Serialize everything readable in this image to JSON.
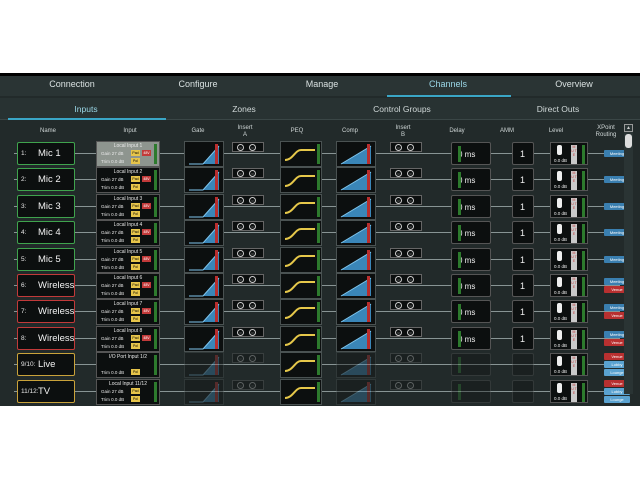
{
  "top_tabs": [
    "Connection",
    "Configure",
    "Manage",
    "Channels",
    "Overview"
  ],
  "active_top_tab": "Channels",
  "sub_tabs": [
    "Inputs",
    "Zones",
    "Control Groups",
    "Direct Outs"
  ],
  "active_sub_tab": "Inputs",
  "headers": {
    "name": "Name",
    "input": "Input",
    "gate": "Gate",
    "insert_a": "Insert\nA",
    "peq": "PEQ",
    "comp": "Comp",
    "insert_b": "Insert\nB",
    "delay": "Delay",
    "amm": "AMM",
    "level": "Level",
    "xpoint": "XPoint\nRouting"
  },
  "input_labels": {
    "gain": "Gain 27 dB",
    "trim": "Trim 0.0 dB",
    "pad": "Pad",
    "phantom": "48V",
    "polarity": "Pol"
  },
  "level_db": "0.0 dB",
  "mute_label": "M U T E",
  "rows": [
    {
      "num": "1:",
      "name": "Mic 1",
      "input": "Local Input 1",
      "delay": "0 ms",
      "amm": "1",
      "color": "green",
      "xpoint": [
        "Meeting"
      ],
      "selected": true
    },
    {
      "num": "2:",
      "name": "Mic 2",
      "input": "Local Input 2",
      "delay": "0 ms",
      "amm": "1",
      "color": "green",
      "xpoint": [
        "Meeting"
      ]
    },
    {
      "num": "3:",
      "name": "Mic 3",
      "input": "Local Input 3",
      "delay": "0 ms",
      "amm": "1",
      "color": "green",
      "xpoint": [
        "Meeting"
      ]
    },
    {
      "num": "4:",
      "name": "Mic 4",
      "input": "Local Input 4",
      "delay": "0 ms",
      "amm": "1",
      "color": "green",
      "xpoint": [
        "Meeting"
      ]
    },
    {
      "num": "5:",
      "name": "Mic 5",
      "input": "Local Input 5",
      "delay": "0 ms",
      "amm": "1",
      "color": "green",
      "xpoint": [
        "Meeting"
      ]
    },
    {
      "num": "6:",
      "name": "Wireless",
      "input": "Local Input 6",
      "delay": "0 ms",
      "amm": "1",
      "color": "red",
      "xpoint": [
        "Meeting",
        "Venue"
      ]
    },
    {
      "num": "7:",
      "name": "Wireless",
      "input": "Local Input 7",
      "delay": "0 ms",
      "amm": "1",
      "color": "red",
      "xpoint": [
        "Meeting",
        "Venue"
      ]
    },
    {
      "num": "8:",
      "name": "Wireless",
      "input": "Local Input 8",
      "delay": "0 ms",
      "amm": "1",
      "color": "red",
      "xpoint": [
        "Meeting",
        "Venue"
      ]
    },
    {
      "num": "9/10:",
      "name": "Live",
      "input": "I/O Port Input 1/2",
      "delay": "",
      "amm": "",
      "color": "gold",
      "xpoint": [
        "Venue",
        "Lobby",
        "Lounge"
      ],
      "stereo": true
    },
    {
      "num": "11/12:",
      "name": "TV",
      "input": "Local Input 11/12",
      "delay": "",
      "amm": "",
      "color": "gold",
      "xpoint": [
        "Venue",
        "Lobby",
        "Lounge"
      ],
      "stereo": true
    }
  ],
  "colors": {
    "accent": "#3aa6c6",
    "green": "#3fa34d",
    "red": "#c23a3a",
    "gold": "#c9a23a"
  }
}
